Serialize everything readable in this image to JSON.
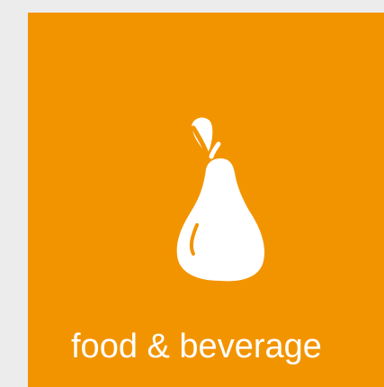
{
  "tile": {
    "label": "food & beverage",
    "icon": "pear-icon",
    "background_color": "#f29400",
    "text_color": "#ffffff"
  },
  "page": {
    "background_color": "#ececec"
  }
}
